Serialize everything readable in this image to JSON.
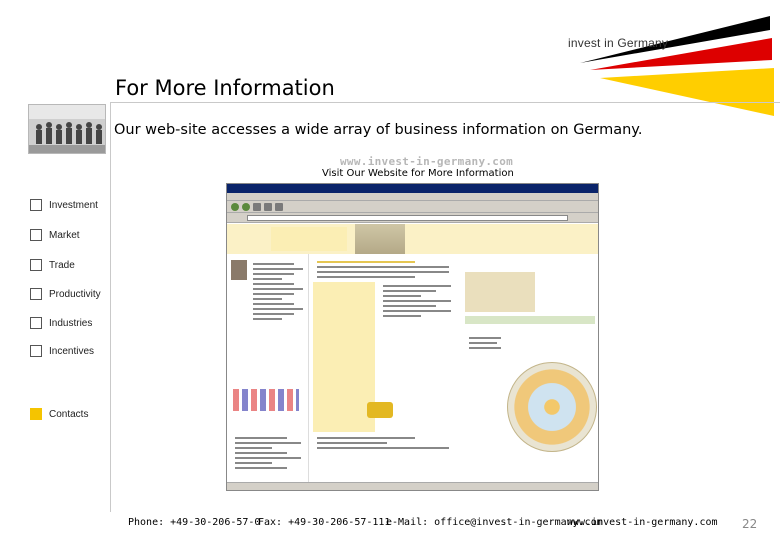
{
  "brand": {
    "logo_text": "invest in Germany"
  },
  "title": "For More Information",
  "subtitle": "Our web-site accesses a wide array of business information on Germany.",
  "website_url": "www.invest-in-germany.com",
  "visit_caption": "Visit Our Website for More Information",
  "nav": {
    "items": [
      {
        "label": "Investment",
        "active": false
      },
      {
        "label": "Market",
        "active": false
      },
      {
        "label": "Trade",
        "active": false
      },
      {
        "label": "Productivity",
        "active": false
      },
      {
        "label": "Industries",
        "active": false
      },
      {
        "label": "Incentives",
        "active": false
      },
      {
        "label": "Contacts",
        "active": true
      }
    ]
  },
  "footer": {
    "phone": "Phone: +49-30-206-57-0",
    "fax": "Fax: +49-30-206-57-111",
    "email": "e-Mail: office@invest-in-germany.com",
    "web": "www.invest-in-germany.com"
  },
  "page_number": "22",
  "colors": {
    "accent": "#f5c400",
    "flag_black": "#000000",
    "flag_red": "#dd0000",
    "flag_gold": "#ffce00"
  },
  "icons": {
    "nav_checkbox": "square-icon",
    "logo_graphic": "german-flag-swoosh-icon"
  }
}
